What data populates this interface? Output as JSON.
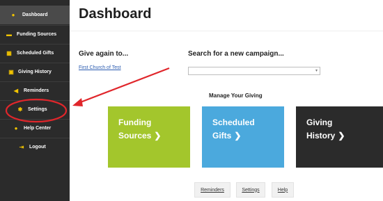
{
  "sidebar": {
    "items": [
      {
        "label": "Dashboard",
        "icon": "dashboard-icon",
        "active": true
      },
      {
        "label": "Funding Sources",
        "icon": "bank-icon"
      },
      {
        "label": "Scheduled Gifts",
        "icon": "calendar-icon"
      },
      {
        "label": "Giving History",
        "icon": "receipt-icon"
      },
      {
        "label": "Reminders",
        "icon": "megaphone-icon"
      },
      {
        "label": "Settings",
        "icon": "gear-icon"
      },
      {
        "label": "Help Center",
        "icon": "question-icon"
      },
      {
        "label": "Logout",
        "icon": "logout-icon"
      }
    ]
  },
  "header": {
    "title": "Dashboard"
  },
  "give_again": {
    "title": "Give again to...",
    "link": "First Church of Test"
  },
  "search": {
    "title": "Search for a new campaign...",
    "value": ""
  },
  "manage": {
    "title": "Manage Your Giving",
    "tiles": [
      {
        "line1": "Funding",
        "line2": "Sources",
        "color": "#a3c62c"
      },
      {
        "line1": "Scheduled",
        "line2": "Gifts",
        "color": "#4ba9dd"
      },
      {
        "line1": "Giving",
        "line2": "History",
        "color": "#2b2b2b"
      }
    ]
  },
  "footer_links": [
    "Reminders",
    "Settings",
    "Help"
  ],
  "colors": {
    "accent": "#f2c400",
    "annotation": "#e0262b",
    "sidebar_bg": "#2b2b2b"
  }
}
